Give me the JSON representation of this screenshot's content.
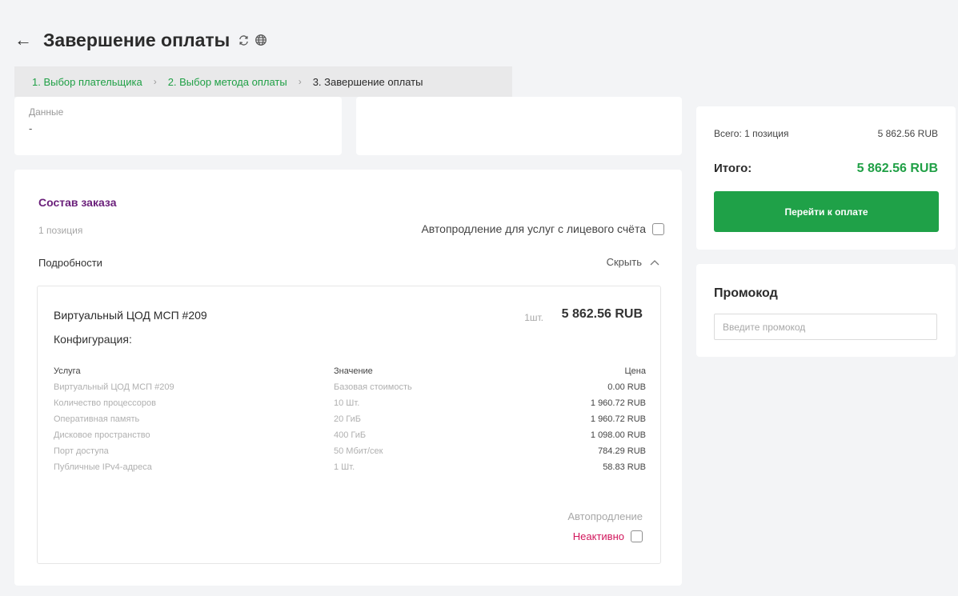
{
  "header": {
    "title": "Завершение оплаты",
    "back_icon": "arrow-left-icon",
    "refresh_icon": "refresh-icon",
    "globe_icon": "globe-icon"
  },
  "breadcrumb": {
    "step1": "1. Выбор плательщика",
    "step2": "2. Выбор метода оплаты",
    "step3": "3. Завершение оплаты",
    "separator": "›"
  },
  "data_card": {
    "label": "Данные",
    "value": "-"
  },
  "order": {
    "title": "Состав заказа",
    "count": "1 позиция",
    "autorenew_label": "Автопродление для услуг с лицевого счёта",
    "details_label": "Подробности",
    "hide_label": "Скрыть",
    "item": {
      "name": "Виртуальный ЦОД МСП #209",
      "qty": "1шт.",
      "price": "5 862.56 RUB",
      "config_label": "Конфигурация:",
      "columns": {
        "service": "Услуга",
        "value": "Значение",
        "price": "Цена"
      },
      "rows": [
        {
          "service": "Виртуальный ЦОД МСП #209",
          "value": "Базовая стоимость",
          "price": "0.00 RUB"
        },
        {
          "service": "Количество процессоров",
          "value": "10 Шт.",
          "price": "1 960.72 RUB"
        },
        {
          "service": "Оперативная память",
          "value": "20 ГиБ",
          "price": "1 960.72 RUB"
        },
        {
          "service": "Дисковое пространство",
          "value": "400 ГиБ",
          "price": "1 098.00 RUB"
        },
        {
          "service": "Порт доступа",
          "value": "50 Мбит/сек",
          "price": "784.29 RUB"
        },
        {
          "service": "Публичные IPv4-адреса",
          "value": "1 Шт.",
          "price": "58.83 RUB"
        }
      ],
      "autorenew_label": "Автопродление",
      "autorenew_status": "Неактивно"
    }
  },
  "summary": {
    "total_positions_label": "Всего: 1 позиция",
    "total_positions_value": "5 862.56 RUB",
    "total_label": "Итого:",
    "total_value": "5 862.56 RUB",
    "pay_button": "Перейти к оплате"
  },
  "promo": {
    "title": "Промокод",
    "placeholder": "Введите промокод"
  },
  "colors": {
    "accent_green": "#20a046",
    "title_purple": "#6a1f7a",
    "inactive_red": "#d1155b"
  }
}
